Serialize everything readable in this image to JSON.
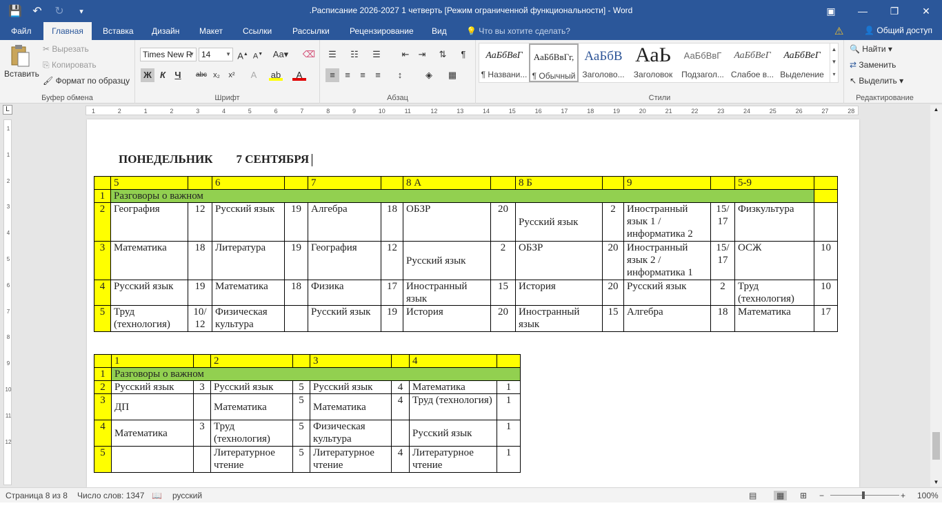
{
  "window": {
    "title": ".Расписание 2026-2027 1 четверть [Режим ограниченной функциональности] - Word"
  },
  "tabs": [
    "Файл",
    "Главная",
    "Вставка",
    "Дизайн",
    "Макет",
    "Ссылки",
    "Рассылки",
    "Рецензирование",
    "Вид"
  ],
  "tell_me": "Что вы хотите сделать?",
  "share": "Общий доступ",
  "clipboard": {
    "paste": "Вставить",
    "cut": "Вырезать",
    "copy": "Копировать",
    "format_painter": "Формат по образцу",
    "label": "Буфер обмена"
  },
  "font": {
    "name": "Times New R",
    "size": "14",
    "label": "Шрифт",
    "bold": "Ж",
    "italic": "К",
    "underline": "Ч",
    "strike": "abc",
    "sub": "x₂",
    "sup": "x²"
  },
  "paragraph": {
    "label": "Абзац"
  },
  "styles": {
    "label": "Стили",
    "items": [
      {
        "preview": "АаБбВвГ",
        "name": "¶ Названи..."
      },
      {
        "preview": "АаБбВвГг,",
        "name": "¶ Обычный"
      },
      {
        "preview": "АаБбВ",
        "name": "Заголово..."
      },
      {
        "preview": "АаЬ",
        "name": "Заголовок"
      },
      {
        "preview": "АаБбВвГ",
        "name": "Подзагол..."
      },
      {
        "preview": "АаБбВеГ",
        "name": "Слабое в..."
      },
      {
        "preview": "АаБбВеГ",
        "name": "Выделение"
      }
    ]
  },
  "editing": {
    "find": "Найти",
    "replace": "Заменить",
    "select": "Выделить",
    "label": "Редактирование"
  },
  "ruler": [
    "1",
    "2",
    "1",
    "2",
    "3",
    "4",
    "5",
    "6",
    "7",
    "8",
    "9",
    "10",
    "11",
    "12",
    "13",
    "14",
    "15",
    "16",
    "17",
    "18",
    "19",
    "20",
    "21",
    "22",
    "23",
    "24",
    "25",
    "26",
    "27",
    "28"
  ],
  "vruler": [
    "1",
    "1",
    "2",
    "3",
    "4",
    "5",
    "6",
    "7",
    "8",
    "9",
    "10",
    "11",
    "12"
  ],
  "document": {
    "heading_day": "ПОНЕДЕЛЬНИК",
    "heading_date": "7 СЕНТЯБРЯ",
    "table1": {
      "headers": [
        "5",
        "6",
        "7",
        "8 А",
        "8 Б",
        "9",
        "5-9"
      ],
      "row1": {
        "num": "1",
        "text": "Разговоры о важном"
      },
      "rows": [
        {
          "num": "2",
          "cells": [
            "География",
            "12",
            "Русский язык",
            "19",
            "Алгебра",
            "18",
            "ОБЗР",
            "20",
            "Русский язык",
            "2",
            "Иностранный язык 1 / информатика 2",
            "15/ 17",
            "Физкультура",
            ""
          ]
        },
        {
          "num": "3",
          "cells": [
            "Математика",
            "18",
            "Литература",
            "19",
            "География",
            "12",
            "Русский язык",
            "2",
            "ОБЗР",
            "20",
            "Иностранный язык 2 / информатика 1",
            "15/ 17",
            "ОСЖ",
            "10"
          ]
        },
        {
          "num": "4",
          "cells": [
            "Русский язык",
            "19",
            "Математика",
            "18",
            "Физика",
            "17",
            "Иностранный язык",
            "15",
            "История",
            "20",
            "Русский язык",
            "2",
            "Труд (технология)",
            "10"
          ]
        },
        {
          "num": "5",
          "cells": [
            "Труд (технология)",
            "10/ 12",
            "Физическая культура",
            "",
            "Русский язык",
            "19",
            "История",
            "20",
            "Иностранный язык",
            "15",
            "Алгебра",
            "18",
            "Математика",
            "17"
          ]
        }
      ]
    },
    "table2": {
      "headers": [
        "1",
        "2",
        "3",
        "4"
      ],
      "row1": {
        "num": "1",
        "text": "Разговоры о важном"
      },
      "rows": [
        {
          "num": "2",
          "cells": [
            "Русский язык",
            "3",
            "Русский язык",
            "5",
            "Русский язык",
            "4",
            "Математика",
            "1"
          ]
        },
        {
          "num": "3",
          "cells": [
            "ДП",
            "",
            "Математика",
            "5",
            "Математика",
            "4",
            "Труд (технология)",
            "1"
          ]
        },
        {
          "num": "4",
          "cells": [
            "Математика",
            "3",
            "Труд (технология)",
            "5",
            "Физическая культура",
            "",
            "Русский язык",
            "1"
          ]
        },
        {
          "num": "5",
          "cells": [
            "",
            "",
            "Литературное чтение",
            "5",
            "Литературное чтение",
            "4",
            "Литературное чтение",
            "1"
          ]
        }
      ]
    }
  },
  "status": {
    "page": "Страница 8 из 8",
    "words": "Число слов: 1347",
    "lang": "русский",
    "zoom": "100%"
  },
  "colors": {
    "brand": "#2b579a",
    "yellow": "#ffff00",
    "green": "#92d050"
  }
}
